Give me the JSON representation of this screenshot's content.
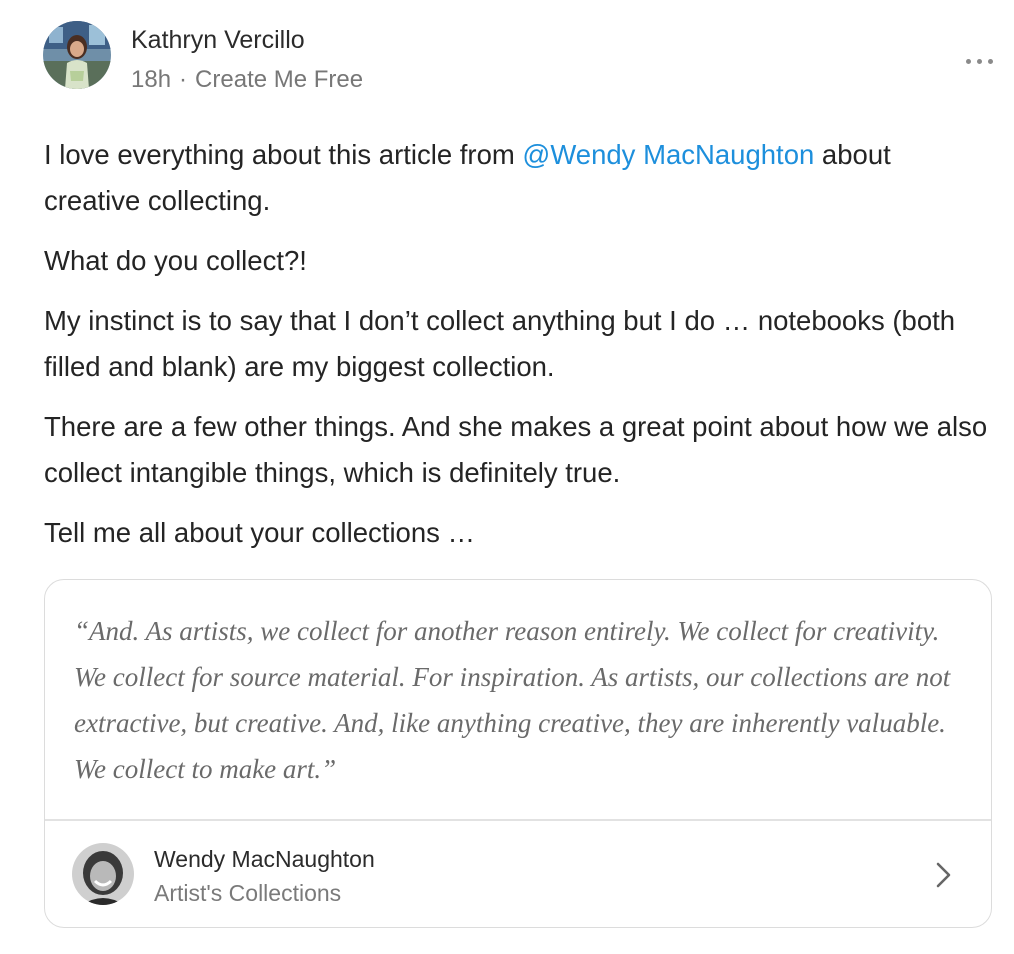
{
  "author": {
    "name": "Kathryn Vercillo",
    "time": "18h",
    "separator": "·",
    "publication": "Create Me Free"
  },
  "post": {
    "p1_before": "I love everything about this article from ",
    "mention": "@Wendy MacNaughton",
    "p1_after": " about creative collecting.",
    "p2": "What do you collect?!",
    "p3": "My instinct is to say that I don’t collect anything but I do … notebooks (both filled and blank) are my biggest collection.",
    "p4": "There are a few other things. And she makes a great point about how we also collect intangible things, which is definitely true.",
    "p5": "Tell me all about your collections …"
  },
  "quote_card": {
    "quote": "“And. As artists, we collect for another reason entirely. We collect for creativity. We collect for source material. For inspiration. As artists, our collections are not extractive, but creative. And, like anything creative, they are inherently valuable. We collect to make art.”",
    "source_author": "Wendy MacNaughton",
    "source_publication": "Artist's Collections"
  },
  "colors": {
    "mention": "#1d8fdc",
    "text": "#242424",
    "muted": "#777777"
  },
  "icons": [
    "author-avatar",
    "more-options-icon",
    "source-avatar",
    "chevron-right-icon"
  ]
}
